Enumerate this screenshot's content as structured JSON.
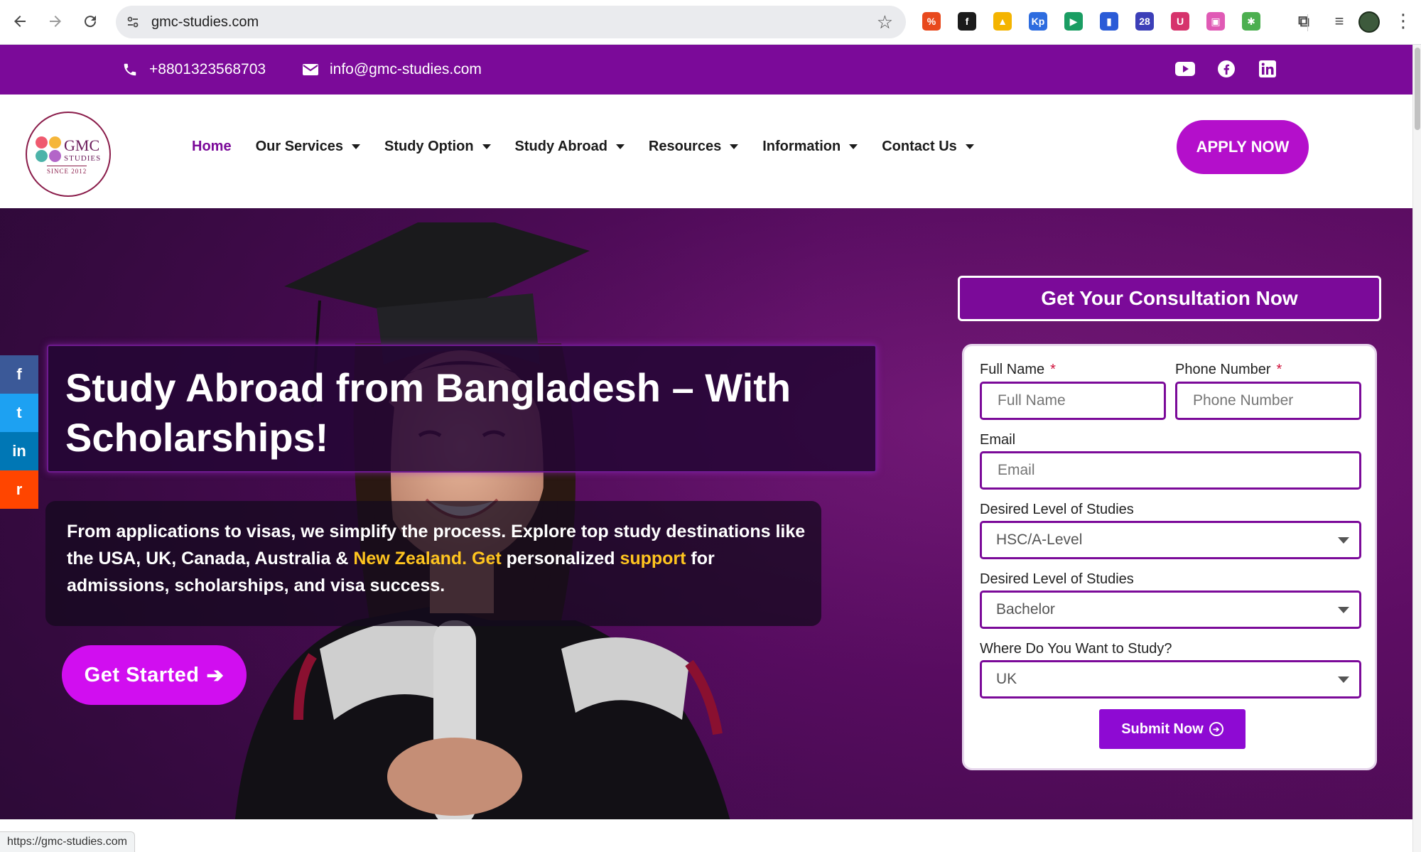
{
  "browser": {
    "url": "gmc-studies.com",
    "status_url": "https://gmc-studies.com",
    "extensions": [
      {
        "name": "percent-extension-icon",
        "color": "#e8491d",
        "glyph": "%"
      },
      {
        "name": "formula-extension-icon",
        "color": "#1b1b1b",
        "glyph": "f"
      },
      {
        "name": "drive-extension-icon",
        "color": "#f4b400",
        "glyph": "▲"
      },
      {
        "name": "kp-extension-icon",
        "color": "#2d6cdf",
        "glyph": "Kp"
      },
      {
        "name": "video-extension-icon",
        "color": "#1a9d63",
        "glyph": "▶"
      },
      {
        "name": "analytics-extension-icon",
        "color": "#2a5bd7",
        "glyph": "▮"
      },
      {
        "name": "cap-extension-icon",
        "color": "#3c3fb8",
        "glyph": "28"
      },
      {
        "name": "shield-extension-icon",
        "color": "#d6336c",
        "glyph": "U"
      },
      {
        "name": "image-extension-icon",
        "color": "#e05ab5",
        "glyph": "▣"
      },
      {
        "name": "bug-extension-icon",
        "color": "#4caf50",
        "glyph": "✱"
      },
      {
        "name": "puzzle-extension-icon",
        "color": "#474747",
        "glyph": "⧉"
      },
      {
        "name": "media-extension-icon",
        "color": "#474747",
        "glyph": "≡"
      }
    ]
  },
  "topbar": {
    "phone": "+8801323568703",
    "email": "info@gmc-studies.com",
    "socials": [
      "youtube-icon",
      "facebook-icon",
      "linkedin-icon"
    ]
  },
  "header": {
    "logo": {
      "line1": "GMC",
      "line2": "STUDIES",
      "line3": "SINCE 2012"
    },
    "menu": [
      {
        "label": "Home",
        "dropdown": false,
        "active": true
      },
      {
        "label": "Our Services",
        "dropdown": true
      },
      {
        "label": "Study Option",
        "dropdown": true
      },
      {
        "label": "Study Abroad",
        "dropdown": true
      },
      {
        "label": "Resources",
        "dropdown": true
      },
      {
        "label": "Information",
        "dropdown": true
      },
      {
        "label": "Contact Us",
        "dropdown": true
      }
    ],
    "apply_label": "APPLY NOW"
  },
  "hero": {
    "headline": "Study Abroad from Bangladesh – With Scholarships!",
    "sub": {
      "part1": "From applications to visas, we simplify the process. Explore top study destinations like the USA, UK, Canada, Australia & ",
      "hl1": "New Zealand. Get",
      "part2": " personalized ",
      "hl2": "support",
      "part3": " for admissions, scholarships, and visa success."
    },
    "cta_label": "Get Started",
    "cta_arrow": "➔"
  },
  "consultation": {
    "title": "Get Your Consultation Now",
    "full_name_label": "Full Name",
    "full_name_placeholder": "Full Name",
    "phone_label": "Phone Number",
    "phone_placeholder": "Phone Number",
    "required_mark": "*",
    "email_label": "Email",
    "email_placeholder": "Email",
    "level1_label": "Desired Level of Studies",
    "level1_value": "HSC/A-Level",
    "level2_label": "Desired Level of Studies",
    "level2_value": "Bachelor",
    "destination_label": "Where Do You Want to Study?",
    "destination_value": "UK",
    "submit_label": "Submit Now",
    "submit_icon": "➔"
  },
  "share_bar": [
    {
      "name": "share-facebook-button",
      "glyph": "f",
      "color": "#3b5998"
    },
    {
      "name": "share-twitter-button",
      "glyph": "t",
      "color": "#1da1f2"
    },
    {
      "name": "share-linkedin-button",
      "glyph": "in",
      "color": "#0077b5"
    },
    {
      "name": "share-reddit-button",
      "glyph": "r",
      "color": "#ff4500"
    }
  ],
  "colors": {
    "brand_purple": "#7b0a99",
    "cta_magenta": "#d10ef0",
    "highlight_yellow": "#ffc51f"
  }
}
